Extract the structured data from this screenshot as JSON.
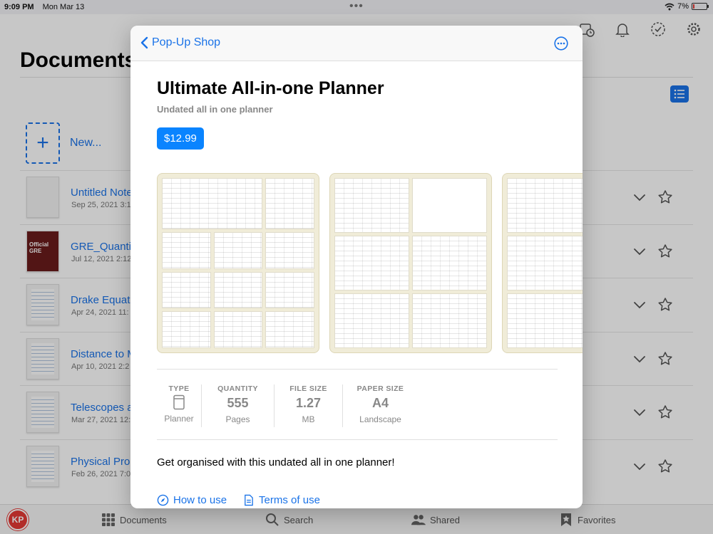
{
  "status_bar": {
    "time": "9:09 PM",
    "date": "Mon Mar 13",
    "battery": "7%",
    "battery_level": 0.07
  },
  "background": {
    "title": "Documents",
    "new_label": "New...",
    "documents": [
      {
        "name": "Untitled Note",
        "date": "Sep 25, 2021 3:1",
        "thumb": "blank"
      },
      {
        "name": "GRE_Quantit",
        "date": "Jul 12, 2021 2:12",
        "thumb": "gre",
        "thumb_text": "Official GRE"
      },
      {
        "name": "Drake Equat",
        "date": "Apr 24, 2021 11:",
        "thumb": "notes"
      },
      {
        "name": "Distance to M",
        "date": "Apr 10, 2021 2:2",
        "thumb": "notes"
      },
      {
        "name": "Telescopes a",
        "date": "Mar 27, 2021 12:",
        "thumb": "notes"
      },
      {
        "name": "Physical Prop",
        "date": "Feb 26, 2021 7:0",
        "thumb": "notes"
      }
    ],
    "tabs": [
      {
        "label": "Documents",
        "icon": "grid-icon"
      },
      {
        "label": "Search",
        "icon": "search-icon"
      },
      {
        "label": "Shared",
        "icon": "people-icon"
      },
      {
        "label": "Favorites",
        "icon": "bookmark-star-icon"
      }
    ],
    "logo_text": "KP"
  },
  "modal": {
    "back_label": "Pop-Up Shop",
    "title": "Ultimate All-in-one Planner",
    "subtitle": "Undated all in one planner",
    "price": "$12.99",
    "specs": [
      {
        "label": "TYPE",
        "value": "",
        "unit": "Planner",
        "icon": "planner-icon"
      },
      {
        "label": "QUANTITY",
        "value": "555",
        "unit": "Pages"
      },
      {
        "label": "FILE SIZE",
        "value": "1.27",
        "unit": "MB"
      },
      {
        "label": "PAPER SIZE",
        "value": "A4",
        "unit": "Landscape"
      }
    ],
    "description": "Get organised with this undated all in one planner!",
    "links": [
      {
        "label": "How to use",
        "icon": "compass-icon"
      },
      {
        "label": "Terms of use",
        "icon": "document-icon"
      }
    ]
  }
}
